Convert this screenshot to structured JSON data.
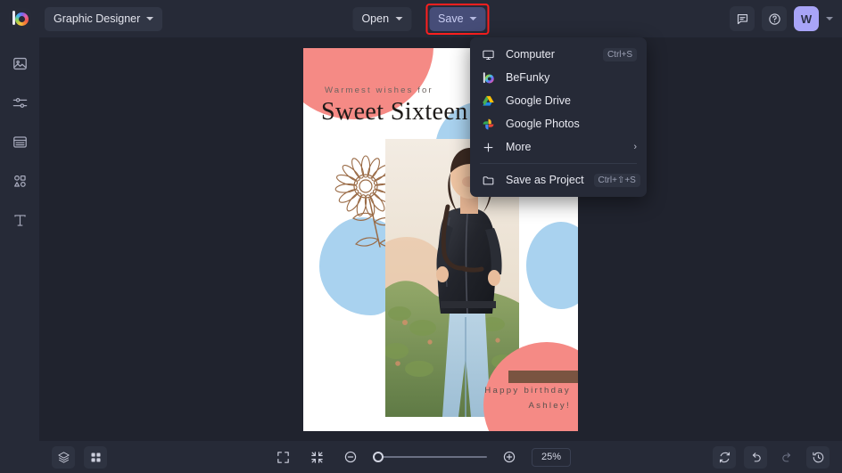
{
  "app": {
    "logo_icon": "befunky-logo-icon",
    "workspace_label": "Graphic Designer"
  },
  "header": {
    "open_label": "Open",
    "save_label": "Save",
    "feedback_icon": "chat-bubble-icon",
    "help_icon": "help-circle-icon",
    "avatar_initial": "W",
    "highlight_color": "#ff1f1f",
    "accent_color": "#464d78",
    "avatar_color": "#a8a4f7"
  },
  "sidebar": {
    "items": [
      {
        "name": "image-icon",
        "label": "Image"
      },
      {
        "name": "adjust-sliders-icon",
        "label": "Edit"
      },
      {
        "name": "templates-icon",
        "label": "Templates"
      },
      {
        "name": "shapes-icon",
        "label": "Graphics"
      },
      {
        "name": "text-icon",
        "label": "Text"
      }
    ]
  },
  "save_menu": {
    "items": [
      {
        "icon": "monitor-icon",
        "label": "Computer",
        "shortcut": "Ctrl+S",
        "arrow": ""
      },
      {
        "icon": "befunky-icon",
        "label": "BeFunky",
        "shortcut": "",
        "arrow": ""
      },
      {
        "icon": "google-drive-icon",
        "label": "Google Drive",
        "shortcut": "",
        "arrow": ""
      },
      {
        "icon": "google-photos-icon",
        "label": "Google Photos",
        "shortcut": "",
        "arrow": ""
      },
      {
        "icon": "plus-icon",
        "label": "More",
        "shortcut": "",
        "arrow": "›"
      }
    ],
    "footer": {
      "icon": "folder-icon",
      "label": "Save as Project",
      "shortcut": "Ctrl+⇧+S"
    }
  },
  "canvas": {
    "design": {
      "line1": "Warmest wishes for",
      "line2": "Sweet Sixteen!",
      "line3": "Happy birthday\nAshley!",
      "colors": {
        "pink": "#f58a85",
        "blue": "#a9d2ef",
        "brown": "#7a5441",
        "paper": "#ffffff"
      }
    }
  },
  "bottombar": {
    "layers_icon": "layers-icon",
    "grid_icon": "grid-icon",
    "fit_icon": "fit-screen-icon",
    "collapse_icon": "collapse-screen-icon",
    "zoom_out_icon": "zoom-out-icon",
    "zoom_in_icon": "zoom-in-icon",
    "zoom_value": "25%",
    "reset_icon": "reset-icon",
    "undo_icon": "undo-icon",
    "redo_icon": "redo-icon",
    "history_icon": "history-icon"
  }
}
